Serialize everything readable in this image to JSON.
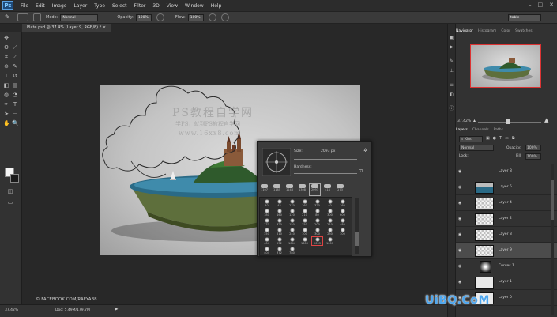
{
  "app": {
    "logo": "Ps"
  },
  "menu": [
    "File",
    "Edit",
    "Image",
    "Layer",
    "Type",
    "Select",
    "Filter",
    "3D",
    "View",
    "Window",
    "Help"
  ],
  "options": {
    "mode_label": "Mode:",
    "mode_value": "Normal",
    "opacity_label": "Opacity:",
    "opacity_value": "100%",
    "flow_label": "Flow:",
    "flow_value": "100%",
    "search_value": "table"
  },
  "document": {
    "tab_title": "Plate.psd @ 37.4% (Layer 9, RGB/8) * ×"
  },
  "canvas": {
    "watermark_title": "PS教程自学网",
    "watermark_line": "学PS，就到PS教程自学网",
    "watermark_url": "www.16xx8.com"
  },
  "brush_panel": {
    "size_label": "Size:",
    "size_value": "2093 px",
    "hardness_label": "Hardness:",
    "row1": [
      "1107",
      "1185",
      "1248",
      "1308",
      "2093",
      "414",
      "273"
    ],
    "row2": [
      "40",
      "45",
      "270",
      "160",
      "320",
      "40",
      "160"
    ],
    "row3": [
      "180",
      "160",
      "120",
      "210",
      "80",
      "300",
      "600"
    ],
    "row4": [
      "170",
      "320",
      "150",
      "350",
      "200",
      "210",
      "480"
    ],
    "row5": [
      "350",
      "210",
      "240",
      "100",
      "300",
      "230",
      "300"
    ],
    "row6": [
      "404",
      "252",
      "1044",
      "1600",
      "2093",
      "1007"
    ],
    "row7": [
      "404",
      "372",
      "780"
    ]
  },
  "copyright": "© FACEBOOK.COM/RAFYA88",
  "status": {
    "zoom": "37.42%",
    "doc": "Doc: 5.49M/179.7M"
  },
  "navigator": {
    "tabs": [
      "Navigator",
      "Histogram",
      "Color",
      "Swatches"
    ],
    "zoom": "37.42%"
  },
  "layers_panel": {
    "tabs": [
      "Layers",
      "Channels",
      "Paths"
    ],
    "kind_label": "Kind",
    "blend_value": "Normal",
    "opacity_label": "Opacity:",
    "opacity_value": "100%",
    "lock_label": "Lock:",
    "fill_label": "Fill:",
    "fill_value": "100%",
    "layers": [
      {
        "name": "Layer 8"
      },
      {
        "name": "Layer 5"
      },
      {
        "name": "Layer 4"
      },
      {
        "name": "Layer 2"
      },
      {
        "name": "Layer 3"
      },
      {
        "name": "Layer 9"
      },
      {
        "name": "Curves 1"
      },
      {
        "name": "Layer 1"
      },
      {
        "name": "Layer 0"
      }
    ]
  },
  "site_watermark": "UiBQ.CoM"
}
